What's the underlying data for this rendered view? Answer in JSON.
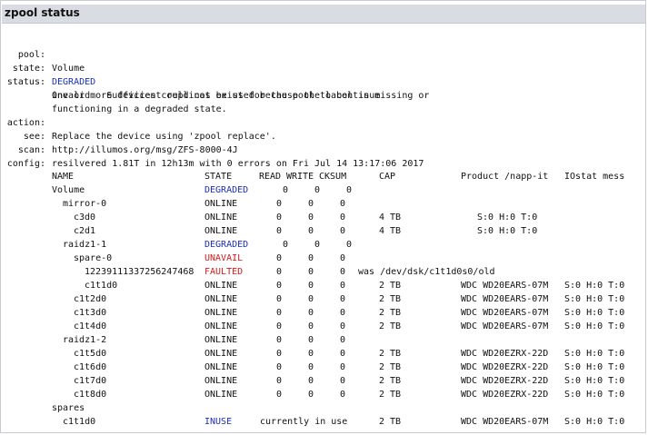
{
  "title": "zpool status",
  "colors": {
    "degraded": "#1a2fb8",
    "unavail": "#d11a1a",
    "inuse": "#1a2fb8"
  },
  "info": {
    "pool_label": "pool:",
    "pool_value": "Volume",
    "state_label": "state:",
    "state_value": "DEGRADED",
    "status_label": "status:",
    "status_lines": [
      "One or more devices could not be used because the label is missing or",
      "invalid.  Sufficient replicas exist for the pool to continue",
      "functioning in a degraded state."
    ],
    "action_label": "action:",
    "action_value": "Replace the device using 'zpool replace'.",
    "see_label": "see:",
    "see_value": "http://illumos.org/msg/ZFS-8000-4J",
    "scan_label": "scan:",
    "scan_value": "resilvered 1.81T in 12h13m with 0 errors on Fri Jul 14 13:17:06 2017",
    "config_label": "config:"
  },
  "table": {
    "headers": {
      "name": "NAME",
      "state": "STATE",
      "read": "READ",
      "write": "WRITE",
      "cksum": "CKSUM",
      "cap": "CAP",
      "product": "Product /napp-it",
      "iostat": "IOstat mess"
    },
    "rows": [
      {
        "name": "Volume",
        "state": "DEGRADED",
        "read": "0",
        "write": "0",
        "cksum": "0",
        "cap": "",
        "product": "",
        "iostat": ""
      },
      {
        "name": "mirror-0",
        "state": "ONLINE",
        "read": "0",
        "write": "0",
        "cksum": "0",
        "cap": "",
        "product": "",
        "iostat": ""
      },
      {
        "name": "c3d0",
        "state": "ONLINE",
        "read": "0",
        "write": "0",
        "cksum": "0",
        "cap": "4 TB",
        "product": "S:0 H:0 T:0",
        "iostat": ""
      },
      {
        "name": "c2d1",
        "state": "ONLINE",
        "read": "0",
        "write": "0",
        "cksum": "0",
        "cap": "4 TB",
        "product": "S:0 H:0 T:0",
        "iostat": ""
      },
      {
        "name": "raidz1-1",
        "state": "DEGRADED",
        "read": "0",
        "write": "0",
        "cksum": "0",
        "cap": "",
        "product": "",
        "iostat": ""
      },
      {
        "name": "spare-0",
        "state": "UNAVAIL",
        "read": "0",
        "write": "0",
        "cksum": "0",
        "cap": "",
        "product": "",
        "iostat": ""
      },
      {
        "name": "1223911133725624746​8",
        "state": "FAULTED",
        "read": "0",
        "write": "0",
        "cksum": "0",
        "cap": "was /dev/dsk/c1t1d0s0/old",
        "product": "",
        "iostat": ""
      },
      {
        "name": "c1t1d0",
        "state": "ONLINE",
        "read": "0",
        "write": "0",
        "cksum": "0",
        "cap": "2 TB",
        "product": "WDC WD20EARS-07M",
        "iostat": "S:0 H:0 T:0"
      },
      {
        "name": "c1t2d0",
        "state": "ONLINE",
        "read": "0",
        "write": "0",
        "cksum": "0",
        "cap": "2 TB",
        "product": "WDC WD20EARS-07M",
        "iostat": "S:0 H:0 T:0"
      },
      {
        "name": "c1t3d0",
        "state": "ONLINE",
        "read": "0",
        "write": "0",
        "cksum": "0",
        "cap": "2 TB",
        "product": "WDC WD20EARS-07M",
        "iostat": "S:0 H:0 T:0"
      },
      {
        "name": "c1t4d0",
        "state": "ONLINE",
        "read": "0",
        "write": "0",
        "cksum": "0",
        "cap": "2 TB",
        "product": "WDC WD20EARS-07M",
        "iostat": "S:0 H:0 T:0"
      },
      {
        "name": "raidz1-2",
        "state": "ONLINE",
        "read": "0",
        "write": "0",
        "cksum": "0",
        "cap": "",
        "product": "",
        "iostat": ""
      },
      {
        "name": "c1t5d0",
        "state": "ONLINE",
        "read": "0",
        "write": "0",
        "cksum": "0",
        "cap": "2 TB",
        "product": "WDC WD20EZRX-22D",
        "iostat": "S:0 H:0 T:0"
      },
      {
        "name": "c1t6d0",
        "state": "ONLINE",
        "read": "0",
        "write": "0",
        "cksum": "0",
        "cap": "2 TB",
        "product": "WDC WD20EZRX-22D",
        "iostat": "S:0 H:0 T:0"
      },
      {
        "name": "c1t7d0",
        "state": "ONLINE",
        "read": "0",
        "write": "0",
        "cksum": "0",
        "cap": "2 TB",
        "product": "WDC WD20EZRX-22D",
        "iostat": "S:0 H:0 T:0"
      },
      {
        "name": "c1t8d0",
        "state": "ONLINE",
        "read": "0",
        "write": "0",
        "cksum": "0",
        "cap": "2 TB",
        "product": "WDC WD20EZRX-22D",
        "iostat": "S:0 H:0 T:0"
      },
      {
        "name": "spares",
        "state": "",
        "read": "",
        "write": "",
        "cksum": "",
        "cap": "",
        "product": "",
        "iostat": ""
      },
      {
        "name": "c1t1d0",
        "state": "INUSE",
        "read": "currently in use",
        "write": "",
        "cksum": "",
        "cap": "2 TB",
        "product": "WDC WD20EARS-07M",
        "iostat": "S:0 H:0 T:0"
      }
    ]
  }
}
